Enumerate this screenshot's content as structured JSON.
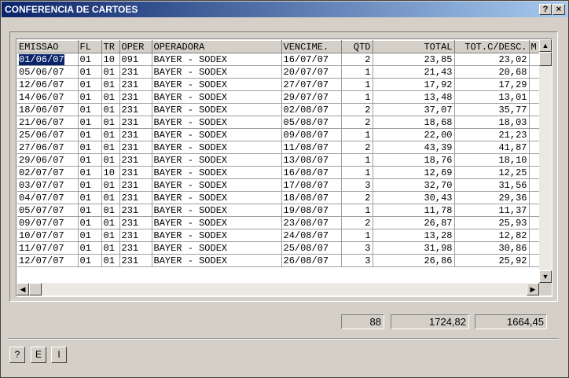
{
  "window": {
    "title": "CONFERENCIA DE CARTOES",
    "help_btn": "?",
    "close_btn": "×"
  },
  "table": {
    "columns": [
      "EMISSAO",
      "FL",
      "TR",
      "OPER",
      "OPERADORA",
      "VENCIME.",
      "QTD",
      "TOTAL",
      "TOT.C/DESC.",
      "M"
    ],
    "rows": [
      [
        "01/06/07",
        "01",
        "10",
        "091",
        "BAYER - SODEX",
        "16/07/07",
        "2",
        "23,85",
        "23,02",
        ""
      ],
      [
        "05/06/07",
        "01",
        "01",
        "231",
        "BAYER - SODEX",
        "20/07/07",
        "1",
        "21,43",
        "20,68",
        ""
      ],
      [
        "12/06/07",
        "01",
        "01",
        "231",
        "BAYER - SODEX",
        "27/07/07",
        "1",
        "17,92",
        "17,29",
        ""
      ],
      [
        "14/06/07",
        "01",
        "01",
        "231",
        "BAYER - SODEX",
        "29/07/07",
        "1",
        "13,48",
        "13,01",
        ""
      ],
      [
        "18/06/07",
        "01",
        "01",
        "231",
        "BAYER - SODEX",
        "02/08/07",
        "2",
        "37,07",
        "35,77",
        ""
      ],
      [
        "21/06/07",
        "01",
        "01",
        "231",
        "BAYER - SODEX",
        "05/08/07",
        "2",
        "18,68",
        "18,03",
        ""
      ],
      [
        "25/06/07",
        "01",
        "01",
        "231",
        "BAYER - SODEX",
        "09/08/07",
        "1",
        "22,00",
        "21,23",
        ""
      ],
      [
        "27/06/07",
        "01",
        "01",
        "231",
        "BAYER - SODEX",
        "11/08/07",
        "2",
        "43,39",
        "41,87",
        ""
      ],
      [
        "29/06/07",
        "01",
        "01",
        "231",
        "BAYER - SODEX",
        "13/08/07",
        "1",
        "18,76",
        "18,10",
        ""
      ],
      [
        "02/07/07",
        "01",
        "10",
        "231",
        "BAYER - SODEX",
        "16/08/07",
        "1",
        "12,69",
        "12,25",
        ""
      ],
      [
        "03/07/07",
        "01",
        "01",
        "231",
        "BAYER - SODEX",
        "17/08/07",
        "3",
        "32,70",
        "31,56",
        ""
      ],
      [
        "04/07/07",
        "01",
        "01",
        "231",
        "BAYER - SODEX",
        "18/08/07",
        "2",
        "30,43",
        "29,36",
        ""
      ],
      [
        "05/07/07",
        "01",
        "01",
        "231",
        "BAYER - SODEX",
        "19/08/07",
        "1",
        "11,78",
        "11,37",
        ""
      ],
      [
        "09/07/07",
        "01",
        "01",
        "231",
        "BAYER - SODEX",
        "23/08/07",
        "2",
        "26,87",
        "25,93",
        ""
      ],
      [
        "10/07/07",
        "01",
        "01",
        "231",
        "BAYER - SODEX",
        "24/08/07",
        "1",
        "13,28",
        "12,82",
        ""
      ],
      [
        "11/07/07",
        "01",
        "01",
        "231",
        "BAYER - SODEX",
        "25/08/07",
        "3",
        "31,98",
        "30,86",
        ""
      ],
      [
        "12/07/07",
        "01",
        "01",
        "231",
        "BAYER - SODEX",
        "26/08/07",
        "3",
        "26,86",
        "25,92",
        ""
      ]
    ]
  },
  "totals": {
    "qtd": "88",
    "total": "1724,82",
    "total_desc": "1664,45"
  },
  "buttons": {
    "help": "?",
    "e": "E",
    "i": "I"
  },
  "colors": {
    "titlebar_start": "#0a246a",
    "titlebar_end": "#a6caf0",
    "selection": "#0a246a"
  }
}
